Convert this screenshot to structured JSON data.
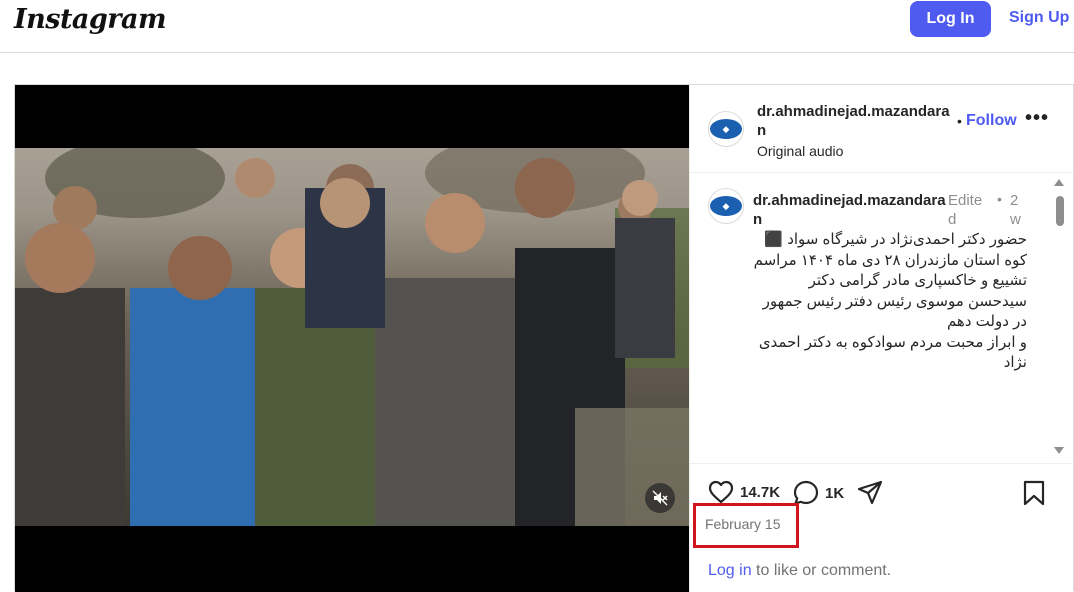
{
  "header": {
    "logo": "Instagram",
    "login_label": "Log In",
    "signup_label": "Sign Up"
  },
  "post": {
    "author": "dr.ahmadinejad.mazandaran",
    "follow_label": "Follow",
    "separator": "•",
    "audio": "Original audio",
    "caption": {
      "author": "dr.ahmadinejad.mazandaran",
      "edited": "Edited",
      "time": "2w",
      "lines": [
        "حضور دکتر احمدی‌نژاد در شیرگاه سواد ⬛",
        "کوه استان مازندران ۲۸ دی ماه ۱۴۰۴ مراسم",
        "تشییع و خاکسپاری مادر گرامی دکتر",
        "سیدحسن موسوی رئیس دفتر رئیس جمهور",
        "در دولت دهم",
        "و ابراز محبت مردم سوادکوه به دکتر احمدی",
        "نژاد"
      ]
    },
    "likes": "14.7K",
    "comments_count": "1K",
    "date": "February 15",
    "login_prompt": {
      "link": "Log in",
      "rest": " to like or comment."
    }
  },
  "icons": {
    "like": "heart-icon",
    "comment": "comment-bubble-icon",
    "share": "share-plane-icon",
    "save": "bookmark-icon",
    "more": "more-options-icon",
    "load_more": "plus-circle-icon",
    "mute": "muted-speaker-icon"
  },
  "colors": {
    "accent": "#4f5bf0",
    "highlight_box": "#d0161c"
  }
}
